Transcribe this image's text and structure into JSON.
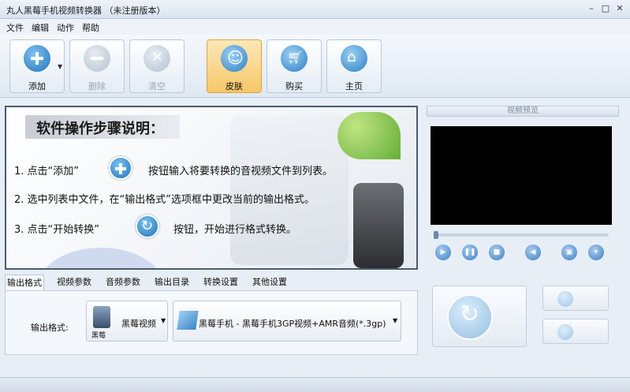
{
  "window": {
    "title": "丸人黑莓手机视频转换器 （未注册版本）"
  },
  "menu": {
    "items": [
      "文件",
      "编辑",
      "动作",
      "帮助"
    ]
  },
  "toolbar": {
    "add": "添加",
    "delete": "删除",
    "clear": "清空",
    "skin": "皮肤",
    "buy": "购买",
    "home": "主页"
  },
  "guide": {
    "title": "软件操作步骤说明：",
    "step1_a": "1. 点击“添加”",
    "step1_b": "按钮输入将要转换的音视频文件到列表。",
    "step2": "2. 选中列表中文件，在“输出格式”选项框中更改当前的输出格式。",
    "step3_a": "3. 点击“开始转换”",
    "step3_b": "按钮，开始进行格式转换。"
  },
  "tabs": [
    "输出格式",
    "视频参数",
    "音频参数",
    "输出目录",
    "转换设置",
    "其他设置"
  ],
  "output": {
    "label": "输出格式:",
    "device_caption": "黑莓",
    "device": "黑莓视频",
    "format": "黑莓手机 - 黑莓手机3GP视频+AMR音频(*.3gp)"
  },
  "preview": {
    "title": "视频预览"
  },
  "colors": {
    "accent": "#1f73b8",
    "skin_highlight": "#f6c868"
  }
}
